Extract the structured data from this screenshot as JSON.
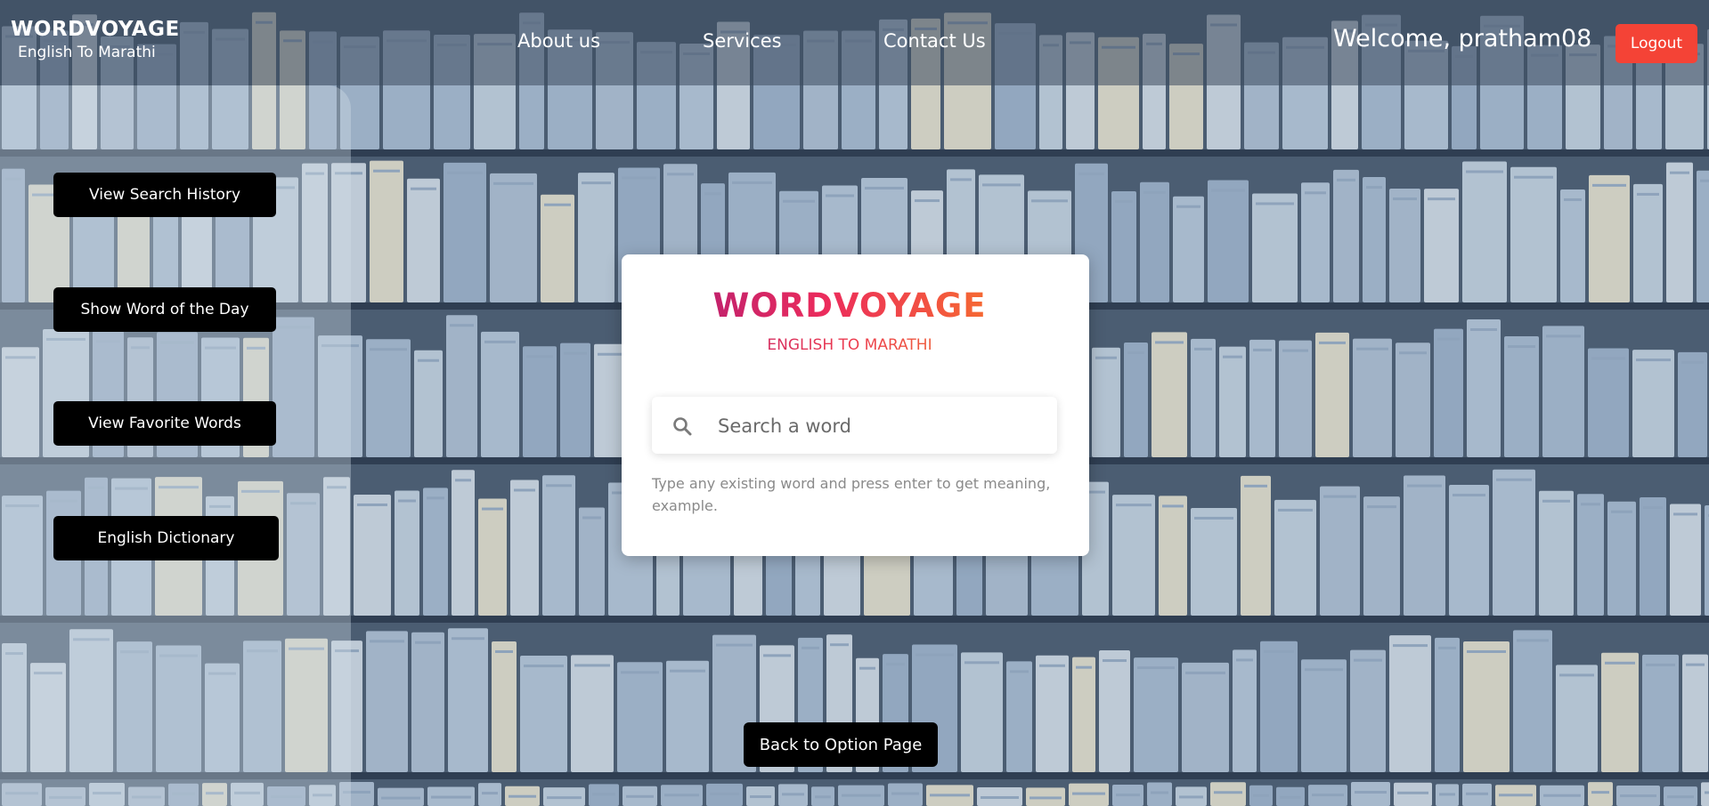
{
  "brand": {
    "title": "WORDVOYAGE",
    "subtitle": "English To Marathi"
  },
  "nav": {
    "about": "About us",
    "services": "Services",
    "contact": "Contact Us"
  },
  "user": {
    "welcome": "Welcome, pratham08",
    "logout_label": "Logout"
  },
  "sidebar": {
    "items": [
      {
        "label": "View Search History"
      },
      {
        "label": "Show Word of the Day"
      },
      {
        "label": "View Favorite Words"
      },
      {
        "label": "English Dictionary"
      }
    ]
  },
  "card": {
    "title": "WORDVOYAGE",
    "subtitle": "ENGLISH TO MARATHI",
    "search": {
      "placeholder": "Search a word",
      "value": ""
    },
    "hint": "Type any existing word and press enter to get meaning, example."
  },
  "footer": {
    "back_label": "Back to Option Page"
  },
  "colors": {
    "logout": "#f44336",
    "button_bg": "#000000",
    "title_gradient_start": "#a31a78",
    "title_gradient_mid": "#ec2c5c",
    "title_gradient_end": "#fb8c1a"
  },
  "icons": {
    "search": "search-icon"
  }
}
